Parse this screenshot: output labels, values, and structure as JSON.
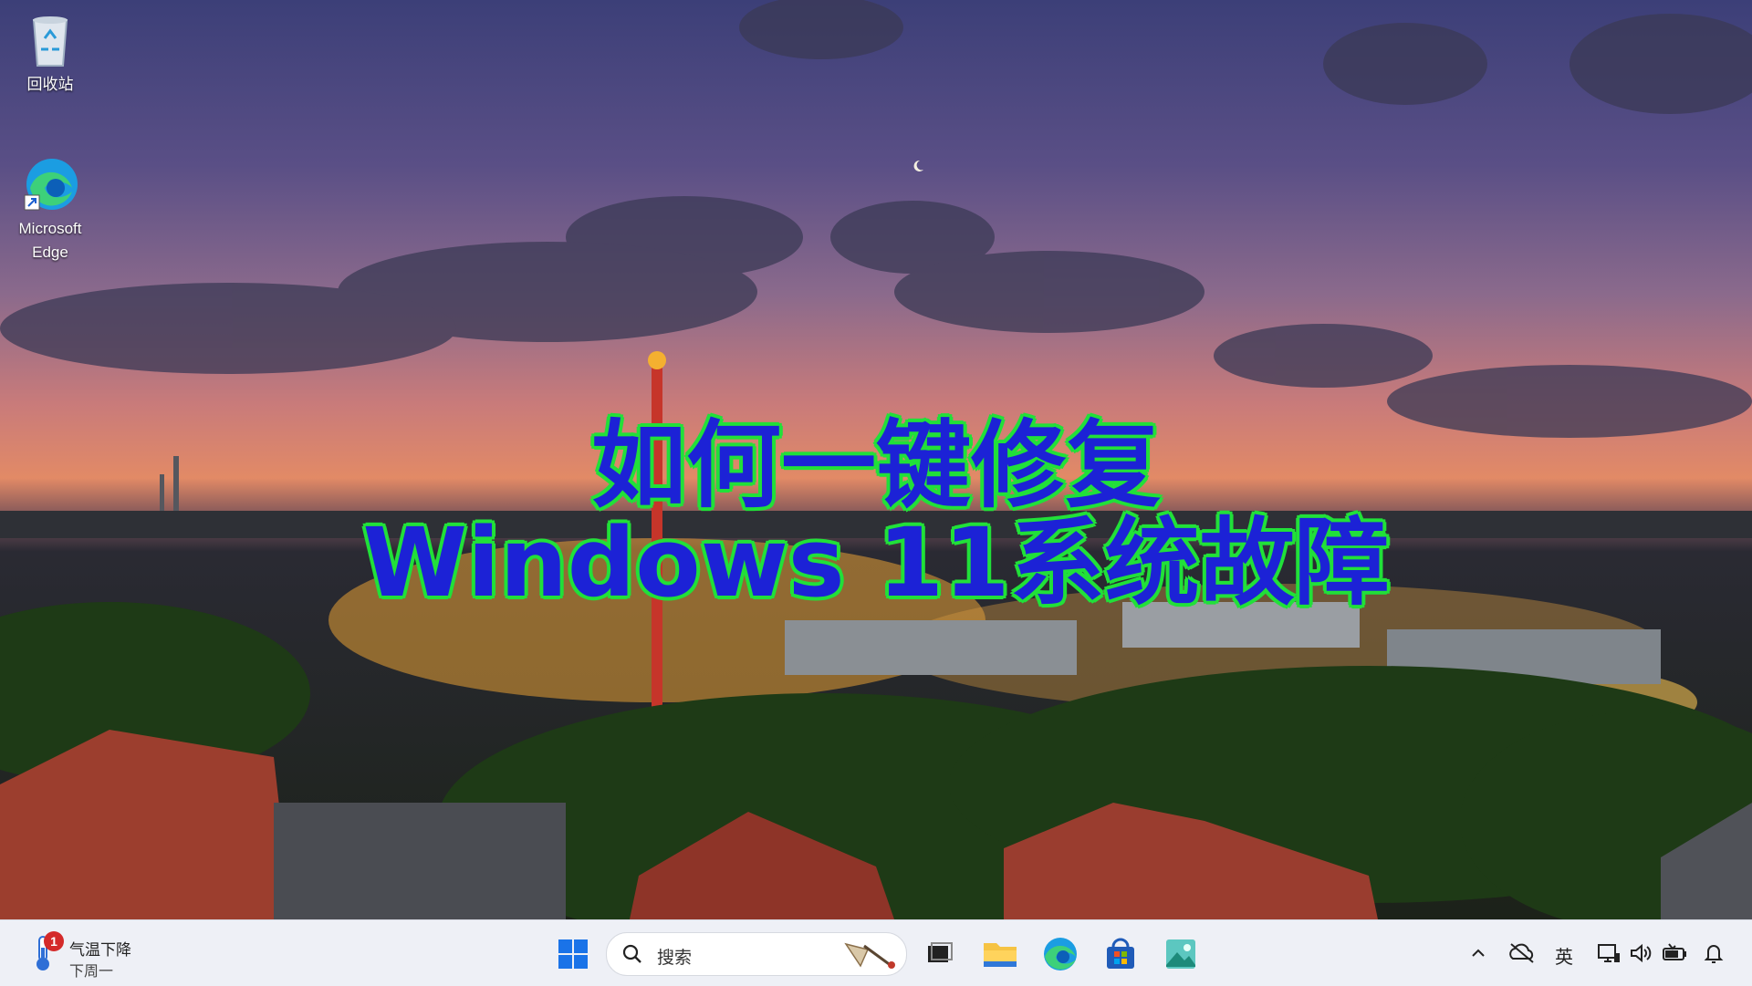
{
  "desktop": {
    "icons": [
      {
        "label": "回收站",
        "icon": "recycle-bin-icon"
      },
      {
        "label": "Microsoft\nEdge",
        "icon": "edge-icon"
      }
    ]
  },
  "overlay_title": {
    "line1": "如何一键修复",
    "line2": "Windows 11系统故障"
  },
  "taskbar": {
    "weather": {
      "alert_count": "1",
      "line1": "气温下降",
      "line2": "下周一"
    },
    "search": {
      "placeholder": "搜索"
    },
    "pinned": [
      "start-icon",
      "task-view-icon",
      "file-explorer-icon",
      "edge-icon",
      "store-icon",
      "photos-icon"
    ],
    "tray": {
      "input_method": "英",
      "icons": [
        "chevron-up-icon",
        "onedrive-icon",
        "display-icon",
        "volume-icon",
        "battery-icon",
        "notification-icon"
      ]
    }
  },
  "colors": {
    "taskbar_bg": "#eef0f6",
    "title_fill": "#1c22d6",
    "title_outline": "#22e03a",
    "win_blue": "#1a73e8"
  }
}
